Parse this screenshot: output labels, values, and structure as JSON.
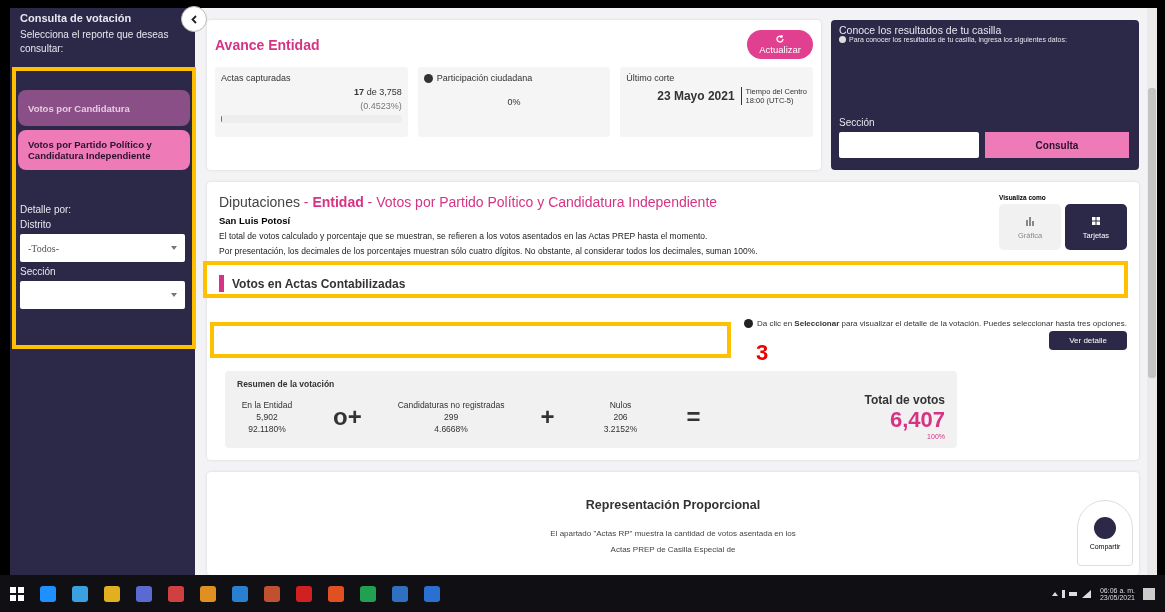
{
  "sidebar": {
    "title": "Consulta de votación",
    "subtitle": "Selecciona el reporte que deseas consultar:",
    "reports": [
      {
        "label": "Votos por Candidatura",
        "selected": false
      },
      {
        "label": "Votos por Partido Político y Candidatura Independiente",
        "selected": true
      }
    ],
    "detail_label": "Detalle por:",
    "filters": [
      {
        "label": "Distrito",
        "value": "-Todos-"
      },
      {
        "label": "Sección"
      }
    ]
  },
  "progress": {
    "title": "Avance Entidad",
    "refresh_button": "Actualizar",
    "actas": {
      "label": "Actas capturadas",
      "count": "17",
      "of": "de 3,758",
      "percent": "(0.4523%)",
      "level": 0.0045
    },
    "participation": {
      "label": "Participación ciudadana",
      "value": "0%"
    },
    "cutoff": {
      "label": "Último corte",
      "date": "23 Mayo 2021",
      "zone": "Tiempo del Centro",
      "time": "18:00 (UTC-5)"
    }
  },
  "lookup": {
    "title": "Conoce los resultados de tu casilla",
    "hint": "Para conocer los resultados de tu casilla, ingresa los siguientes datos:",
    "field_label": "Sección",
    "button": "Consulta"
  },
  "results": {
    "heading": [
      {
        "text": "Diputaciones",
        "kind": "plain"
      },
      {
        "text": " - ",
        "kind": "accent"
      },
      {
        "text": "Entidad",
        "kind": "strong"
      },
      {
        "text": " - Votos por Partido Político y Candidatura Independiente",
        "kind": "accent"
      }
    ],
    "state": "San Luis Potosí",
    "notes": [
      "El total de votos calculado y porcentaje que se muestran, se refieren a los votos asentados en las Actas PREP hasta el momento.",
      "Por presentación, los decimales de los porcentajes muestran sólo cuatro dígitos. No obstante, al considerar todos los decimales, suman 100%."
    ],
    "view_label": "Visualiza como",
    "views": [
      {
        "label": "Gráfica",
        "kind": "chart",
        "selected": false
      },
      {
        "label": "Tarjetas",
        "kind": "cards",
        "selected": true
      }
    ],
    "section_title": "Votos en Actas Contabilizadas",
    "info": "Da clic en **Seleccionar** para visualizar el detalle de la votación. Puedes seleccionar hasta tres opciones.",
    "detail_button": "Ver detalle",
    "summary": {
      "title": "Resumen de la votación",
      "items": [
        {
          "label": "En la Entidad",
          "votes": "5,902",
          "percent": "92.1180%",
          "op": "o+"
        },
        {
          "label": "Candidaturas no registradas",
          "votes": "299",
          "percent": "4.6668%",
          "op": "+"
        },
        {
          "label": "Nulos",
          "votes": "206",
          "percent": "3.2152%",
          "op": "="
        }
      ],
      "total_label": "Total de votos",
      "total": "6,407",
      "total_percent": "100%"
    }
  },
  "rp": {
    "title": "Representación Proporcional",
    "text": "El apartado \"Actas RP\" muestra la cantidad de votos asentada en los Actas PREP de Casilla Especial de"
  },
  "share_button": "Compartir",
  "annotation": "3",
  "taskbar": {
    "time": "06:06 a. m.",
    "date": "23/05/2021"
  }
}
